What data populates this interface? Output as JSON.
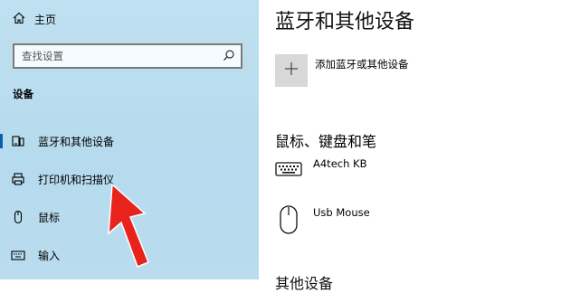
{
  "sidebar": {
    "home_label": "主页",
    "search_placeholder": "查找设置",
    "section_title": "设备",
    "items": [
      {
        "label": "蓝牙和其他设备",
        "icon": "bluetooth-devices-icon",
        "active": true
      },
      {
        "label": "打印机和扫描仪",
        "icon": "printer-icon",
        "active": false
      },
      {
        "label": "鼠标",
        "icon": "mouse-icon",
        "active": false
      },
      {
        "label": "输入",
        "icon": "keyboard-icon",
        "active": false
      }
    ]
  },
  "main": {
    "title": "蓝牙和其他设备",
    "add_device_label": "添加蓝牙或其他设备",
    "section_mouse_keyboard": "鼠标、键盘和笔",
    "devices": [
      {
        "name": "A4tech KB",
        "icon": "keyboard-icon"
      },
      {
        "name": "Usb Mouse",
        "icon": "mouse-icon"
      }
    ],
    "next_section_partial": "其他设备"
  },
  "annotation": {
    "type": "red-arrow",
    "color": "#e8231c"
  },
  "colors": {
    "sidebar_bg": "#b9dcee",
    "active_indicator": "#0b5fa8"
  }
}
